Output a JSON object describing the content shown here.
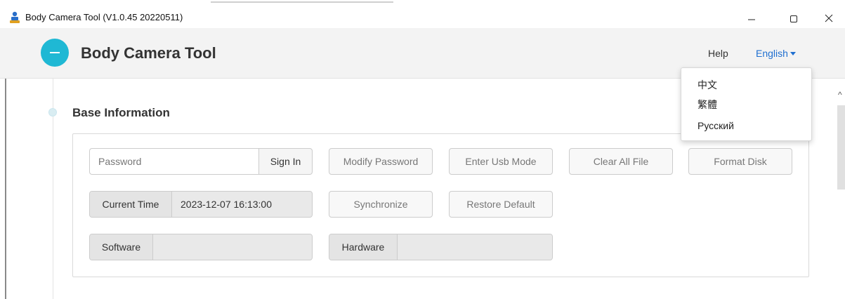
{
  "window": {
    "title": "Body Camera Tool  (V1.0.45 20220511)",
    "icons": {
      "app": "person-camera-icon",
      "minimize": "minimize-icon",
      "maximize": "maximize-icon",
      "close": "close-icon"
    }
  },
  "header": {
    "title": "Body Camera Tool",
    "logo": "circle-logo-icon",
    "help_label": "Help",
    "language_label": "English",
    "accent_color": "#1fb8d4"
  },
  "language_menu": {
    "items": [
      "中文",
      "繁體",
      "Русский"
    ]
  },
  "section": {
    "title": "Base Information"
  },
  "form": {
    "password_placeholder": "Password",
    "signin_label": "Sign In",
    "modify_password_label": "Modify Password",
    "enter_usb_label": "Enter Usb Mode",
    "clear_all_label": "Clear All File",
    "format_disk_label": "Format Disk",
    "current_time_label": "Current Time",
    "current_time_value": "2023-12-07 16:13:00",
    "synchronize_label": "Synchronize",
    "restore_default_label": "Restore Default",
    "software_label": "Software",
    "software_value": "",
    "hardware_label": "Hardware",
    "hardware_value": ""
  }
}
